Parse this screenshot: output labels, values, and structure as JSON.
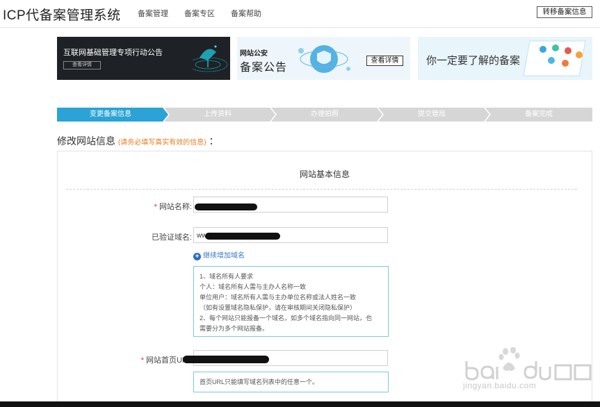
{
  "header": {
    "logo": "ICP代备案管理系统",
    "nav": [
      "备案管理",
      "备案专区",
      "备案帮助"
    ],
    "transfer_button": "转移备案信息"
  },
  "banners": [
    {
      "title": "互联网基础管理专项行动公告",
      "button": "查看详情"
    },
    {
      "subtitle": "网站公安",
      "title": "备案公告",
      "button": "查看详情"
    },
    {
      "title": "你一定要了解的备案"
    }
  ],
  "steps": [
    {
      "label": "变更备案信息",
      "active": true
    },
    {
      "label": "上传资料",
      "active": false
    },
    {
      "label": "办理拍照",
      "active": false
    },
    {
      "label": "提交管局",
      "active": false
    },
    {
      "label": "备案完成",
      "active": false
    }
  ],
  "colors": {
    "step_active": "#2ba3d6",
    "step_inactive": "#d6d6d6",
    "hint": "#e67e22",
    "accent_link": "#3a78c5",
    "tip_border": "#7fc8d4"
  },
  "section": {
    "title": "修改网站信息",
    "hint": "(请务必填写真实有效的信息)",
    "colon": "："
  },
  "form": {
    "panel_title": "网站基本信息",
    "site_name": {
      "required_mark": "*",
      "label": "网站名称:",
      "value": ""
    },
    "domain": {
      "label": "已验证域名:",
      "value": "www"
    },
    "add_domain": "继续增加域名",
    "domain_tip": [
      "1、域名所有人要求",
      "个人：域名所有人需与主办人名称一致",
      "单位用户：域名所有人需与主办单位名称或法人姓名一致",
      "（如有设置域名隐私保护，请在审核期间关闭隐私保护）",
      "2、每个网站只能报备一个域名，如多个域名指向同一网站，也",
      "需要分为多个网站报备。"
    ],
    "homepage_url": {
      "required_mark": "*",
      "label": "网站首页URL",
      "value": ""
    },
    "url_tip": "首页URL只能填写域名列表中的任意一个。"
  },
  "watermark": {
    "text": "jingyan.baidu.com"
  }
}
